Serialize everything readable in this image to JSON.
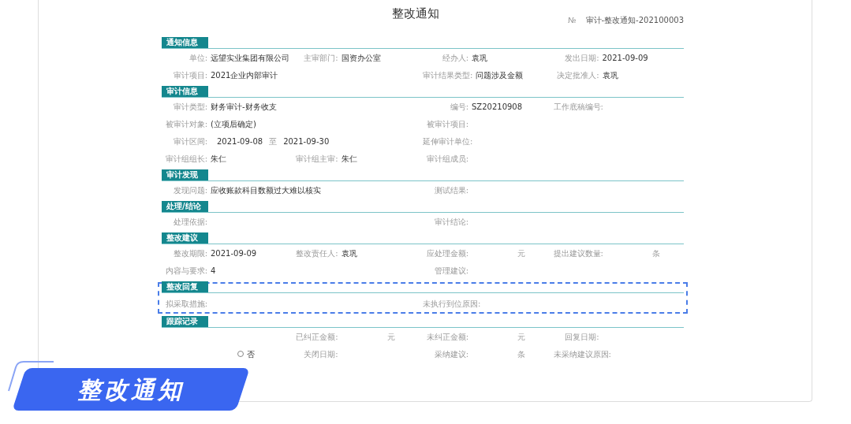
{
  "title": "整改通知",
  "number": {
    "label": "№",
    "value": "审计-整改通知-202100003"
  },
  "sections": [
    {
      "title": "通知信息",
      "highlighted": false,
      "rows": [
        {
          "covered": false,
          "fields": [
            {
              "label": "单位:",
              "value": "远望实业集团有限公司"
            },
            {
              "label": "主审部门:",
              "value": "国资办公室"
            },
            {
              "label": "经办人:",
              "value": "袁巩"
            },
            {
              "label": "发出日期:",
              "value": "2021-09-09"
            }
          ]
        },
        {
          "covered": false,
          "fields": [
            {
              "label": "审计项目:",
              "value": "2021企业内部审计",
              "wide": true
            },
            {
              "label": "审计结果类型:",
              "value": "问题涉及金额"
            },
            {
              "label": "决定批准人:",
              "value": "袁巩"
            }
          ]
        }
      ]
    },
    {
      "title": "审计信息",
      "highlighted": false,
      "rows": [
        {
          "covered": false,
          "fields": [
            {
              "label": "审计类型:",
              "value": "财务审计-财务收支",
              "wide": true
            },
            {
              "label": "编号:",
              "value": "SZ20210908"
            },
            {
              "label": "工作底稿编号:"
            }
          ]
        },
        {
          "covered": false,
          "fields": [
            {
              "label": "被审计对象:",
              "value": "(立项后确定)",
              "wide": true
            },
            {
              "label": "被审计项目:"
            }
          ]
        },
        {
          "covered": false,
          "fields": [
            {
              "label": "审计区间:",
              "value": "2021-09-08",
              "sep": "至",
              "value2": "2021-09-30",
              "wide": true
            },
            {
              "label": "延伸审计单位:"
            }
          ]
        },
        {
          "covered": false,
          "fields": [
            {
              "label": "审计组组长:",
              "value": "朱仁"
            },
            {
              "label": "审计组主审:",
              "value": "朱仁"
            },
            {
              "label": "审计组成员:"
            }
          ]
        }
      ]
    },
    {
      "title": "审计发现",
      "highlighted": false,
      "rows": [
        {
          "covered": false,
          "fields": [
            {
              "label": "发现问题:",
              "value": "应收账款科目数额过大难以核实",
              "wide": true
            },
            {
              "label": "测试结果:"
            }
          ]
        }
      ]
    },
    {
      "title": "处理/结论",
      "highlighted": false,
      "rows": [
        {
          "covered": false,
          "fields": [
            {
              "label": "处理依据:",
              "wide": true
            },
            {
              "label": "审计结论:"
            }
          ]
        }
      ]
    },
    {
      "title": "整改建议",
      "highlighted": false,
      "rows": [
        {
          "covered": false,
          "fields": [
            {
              "label": "整改期限:",
              "value": "2021-09-09"
            },
            {
              "label": "整改责任人:",
              "value": "袁巩"
            },
            {
              "label": "应处理金额:",
              "unit": "元"
            },
            {
              "label": "提出建议数量:",
              "unit": "条"
            }
          ]
        },
        {
          "covered": false,
          "fields": [
            {
              "label": "内容与要求:",
              "value": "4",
              "wide": true
            },
            {
              "label": "管理建议:"
            }
          ]
        }
      ]
    },
    {
      "title": "整改回复",
      "highlighted": true,
      "rows": [
        {
          "covered": false,
          "fields": [
            {
              "label": "拟采取措施:",
              "wide": true
            },
            {
              "label": "未执行到位原因:"
            }
          ]
        }
      ]
    },
    {
      "title": "跟踪记录",
      "highlighted": false,
      "rows": [
        {
          "covered": true,
          "fields": [
            {
              "label": "已纠正金额:",
              "unit": "元"
            },
            {
              "label": "未纠正金额:",
              "unit": "元"
            },
            {
              "label": "回复日期:"
            }
          ]
        },
        {
          "covered": false,
          "fields": [
            {
              "kind": "radio",
              "label": "否",
              "selected": false
            },
            {
              "label": "关闭日期:"
            },
            {
              "label": "采纳建议:",
              "unit": "条"
            },
            {
              "label": "未采纳建议原因:"
            }
          ]
        }
      ]
    }
  ],
  "banner": "整改通知"
}
